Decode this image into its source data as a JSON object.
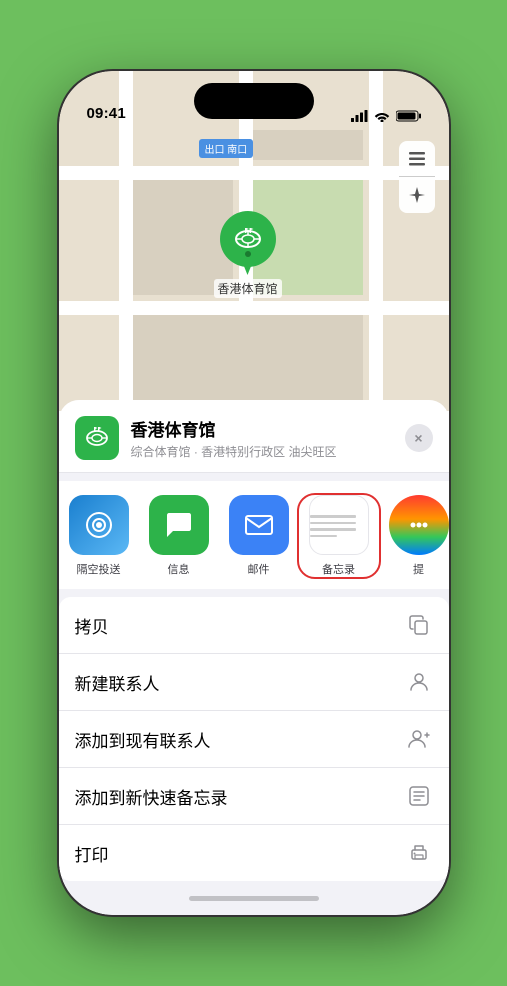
{
  "statusBar": {
    "time": "09:41",
    "locationArrow": true
  },
  "map": {
    "label": "南口",
    "labelPrefix": "出口"
  },
  "venue": {
    "name": "香港体育馆",
    "subtitle": "综合体育馆 · 香港特别行政区 油尖旺区",
    "pinLabel": "香港体育馆"
  },
  "shareItems": [
    {
      "id": "airdrop",
      "label": "隔空投送"
    },
    {
      "id": "messages",
      "label": "信息"
    },
    {
      "id": "mail",
      "label": "邮件"
    },
    {
      "id": "notes",
      "label": "备忘录",
      "selected": true
    },
    {
      "id": "more",
      "label": "提"
    }
  ],
  "actions": [
    {
      "id": "copy",
      "label": "拷贝",
      "icon": "copy"
    },
    {
      "id": "new-contact",
      "label": "新建联系人",
      "icon": "person"
    },
    {
      "id": "add-existing",
      "label": "添加到现有联系人",
      "icon": "person-add"
    },
    {
      "id": "quick-note",
      "label": "添加到新快速备忘录",
      "icon": "note"
    },
    {
      "id": "print",
      "label": "打印",
      "icon": "print"
    }
  ],
  "closeButton": "×"
}
